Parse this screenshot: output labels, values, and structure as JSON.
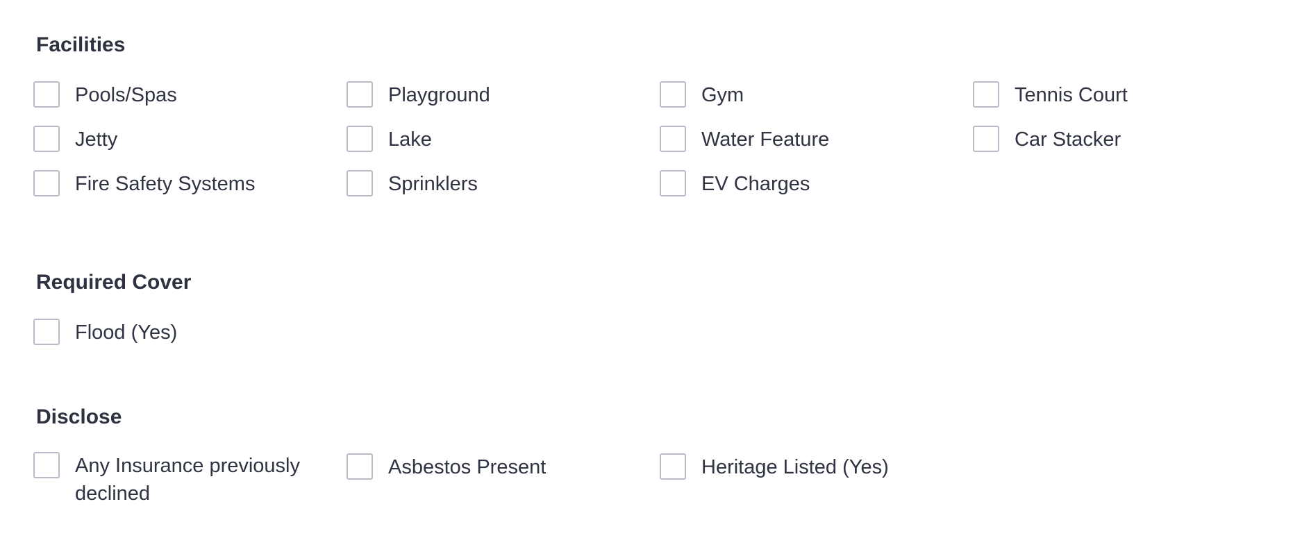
{
  "facilities": {
    "heading": "Facilities",
    "options": [
      "Pools/Spas",
      "Playground",
      "Gym",
      "Tennis Court",
      "Jetty",
      "Lake",
      "Water Feature",
      "Car Stacker",
      "Fire Safety Systems",
      "Sprinklers",
      "EV Charges"
    ]
  },
  "required_cover": {
    "heading": "Required Cover",
    "options": [
      "Flood (Yes)"
    ]
  },
  "disclose": {
    "heading": "Disclose",
    "options": [
      "Any Insurance previously declined",
      "Asbestos Present",
      "Heritage Listed (Yes)"
    ]
  }
}
